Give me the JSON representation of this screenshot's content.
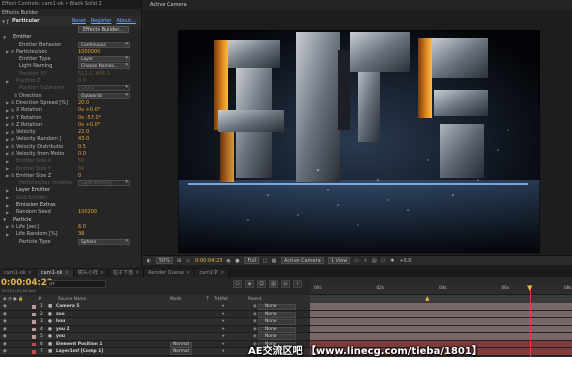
{
  "window": {
    "tab_title": "Effect Controls: cam1-ok • Black Solid 2"
  },
  "effect_controls": {
    "breadcrumb": "Effects Builder",
    "effect_name": "Particular",
    "reset": "Reset",
    "register": "Register",
    "about": "About...",
    "button": "Effects Builder...",
    "rows": [
      {
        "kind": "group",
        "label": "Emitter",
        "twirl": "▼",
        "indent": 1
      },
      {
        "kind": "dropdown",
        "label": "Emitter Behavior",
        "value": "Continuous",
        "indent": 3
      },
      {
        "kind": "value",
        "label": "Particles/sec",
        "value": "1000000",
        "twirl": "▶",
        "stopwatch": "⏱",
        "indent": 2
      },
      {
        "kind": "dropdown",
        "label": "Emitter Type",
        "value": "Layer",
        "indent": 3
      },
      {
        "kind": "dropdown",
        "label": "Light Naming",
        "value": "Choose Names...",
        "indent": 3
      },
      {
        "kind": "dim",
        "label": "Position XY",
        "value": "512.0, 405.0",
        "indent": 3
      },
      {
        "kind": "dim",
        "label": "Position Z",
        "value": "0.0",
        "twirl": "▶",
        "indent": 2
      },
      {
        "kind": "dim",
        "label": "Position Subframe",
        "value": "Linear",
        "dd": true,
        "indent": 3
      },
      {
        "kind": "dropdown",
        "label": "Direction",
        "value": "Outwards",
        "stopwatch": "⏱",
        "indent": 3
      },
      {
        "kind": "value",
        "label": "Direction Spread [%]",
        "value": "20.0",
        "twirl": "▶",
        "stopwatch": "⏱",
        "indent": 2
      },
      {
        "kind": "value",
        "label": "X Rotation",
        "value": "0x +0.0°",
        "twirl": "▶",
        "stopwatch": "⏱",
        "indent": 2
      },
      {
        "kind": "value",
        "label": "Y Rotation",
        "value": "0x -57.0°",
        "twirl": "▶",
        "stopwatch": "⏱",
        "indent": 2
      },
      {
        "kind": "value",
        "label": "Z Rotation",
        "value": "0x +0.0°",
        "twirl": "▶",
        "stopwatch": "⏱",
        "indent": 2
      },
      {
        "kind": "value",
        "label": "Velocity",
        "value": "22.0",
        "twirl": "▶",
        "stopwatch": "⏱",
        "indent": 2
      },
      {
        "kind": "value",
        "label": "Velocity Random [",
        "value": "43.0",
        "twirl": "▶",
        "stopwatch": "⏱",
        "indent": 2
      },
      {
        "kind": "value",
        "label": "Velocity Distributio",
        "value": "0.5",
        "twirl": "▶",
        "stopwatch": "⏱",
        "indent": 2
      },
      {
        "kind": "value",
        "label": "Velocity from Motio",
        "value": "0.0",
        "twirl": "▶",
        "stopwatch": "⏱",
        "indent": 2
      },
      {
        "kind": "dim",
        "label": "Emitter Size X",
        "value": "50",
        "twirl": "▶",
        "indent": 2
      },
      {
        "kind": "dim",
        "label": "Emitter Size Y",
        "value": "50",
        "twirl": "▶",
        "indent": 2
      },
      {
        "kind": "value",
        "label": "Emitter Size Z",
        "value": "0",
        "twirl": "▶",
        "stopwatch": "⏱",
        "indent": 2
      },
      {
        "kind": "dim",
        "label": "Particles/sec modifier",
        "value": "Light Intensity",
        "dd": true,
        "indent": 3
      },
      {
        "kind": "subgroup",
        "label": "Layer Emitter",
        "twirl": "▶",
        "indent": 2
      },
      {
        "kind": "dimgroup",
        "label": "Grid Emitter",
        "twirl": "▶",
        "indent": 2
      },
      {
        "kind": "subgroup",
        "label": "Emission Extras",
        "twirl": "▶",
        "indent": 2
      },
      {
        "kind": "value",
        "label": "Random Seed",
        "value": "100200",
        "twirl": "▶",
        "indent": 2
      },
      {
        "kind": "group",
        "label": "Particle",
        "twirl": "▼",
        "indent": 1
      },
      {
        "kind": "value",
        "label": "Life [sec]",
        "value": "6.0",
        "twirl": "▶",
        "stopwatch": "⏱",
        "indent": 2
      },
      {
        "kind": "value",
        "label": "Life Random [%]",
        "value": "38",
        "twirl": "▶",
        "indent": 2
      },
      {
        "kind": "dropdown",
        "label": "Particle Type",
        "value": "Sphere",
        "indent": 3
      }
    ]
  },
  "viewer": {
    "tab": "Active Camera",
    "zoom": "50%",
    "timecode": "0:00:04:23",
    "resolution": "Full",
    "camera": "Active Camera",
    "views": "1 View",
    "exposure": "+0.0",
    "colors": {
      "accent": "#e6b54a"
    }
  },
  "timeline": {
    "tabs": [
      {
        "label": "cam1-ok",
        "active": false
      },
      {
        "label": "cam1-ok",
        "active": true
      },
      {
        "label": "镜头小样",
        "active": false
      },
      {
        "label": "粒子下落",
        "active": false
      },
      {
        "label": "Render Queue",
        "active": false
      },
      {
        "label": "cam1字",
        "active": false
      }
    ],
    "current_time": "0:00:04:23",
    "fps_info": "00123 (25.00 fps)",
    "search_placeholder": "ρ▾",
    "columns": {
      "source": "Source Name",
      "mode": "Mode",
      "t": "T",
      "trkmat": "TrkMat",
      "parent": "Parent"
    },
    "ruler": [
      "00s",
      "02s",
      "04s",
      "06s",
      "08s"
    ],
    "layers": [
      {
        "num": "1",
        "name": "Camera 5",
        "color": "#b99a9a",
        "mode": "",
        "parent": "None",
        "type": "■"
      },
      {
        "num": "2",
        "name": "zoo",
        "color": "#b99a9a",
        "mode": "",
        "parent": "None",
        "type": "●"
      },
      {
        "num": "3",
        "name": "hou",
        "color": "#b99a9a",
        "mode": "",
        "parent": "None",
        "type": "●"
      },
      {
        "num": "4",
        "name": "you 2",
        "color": "#b99a9a",
        "mode": "",
        "parent": "None",
        "type": "●"
      },
      {
        "num": "5",
        "name": "you",
        "color": "#b99a9a",
        "mode": "",
        "parent": "None",
        "type": "●"
      },
      {
        "num": "6",
        "name": "Element Position 1",
        "color": "#c24a4a",
        "mode": "Normal",
        "parent": "None",
        "type": "■"
      },
      {
        "num": "7",
        "name": "Layer1mf [Comp 1]",
        "color": "#c24a4a",
        "mode": "Normal",
        "parent": "None",
        "type": "■"
      }
    ]
  },
  "watermark": "AE交流区吧 【www.linecg.com/tieba/1801】"
}
